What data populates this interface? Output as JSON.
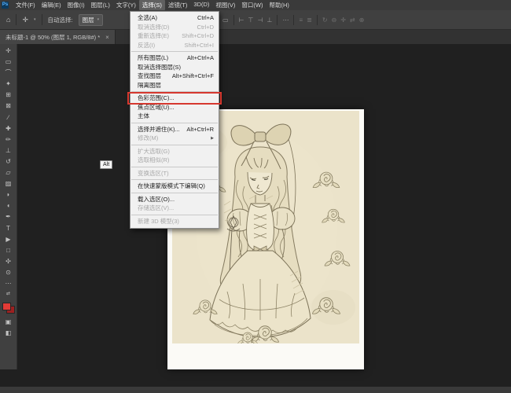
{
  "app": {
    "name": "Photoshop",
    "accent_red": "#d6382f",
    "ps_badge": "Ps"
  },
  "menubar": {
    "active_index": 5,
    "items": [
      {
        "id": "file",
        "label": "文件(F)"
      },
      {
        "id": "edit",
        "label": "编辑(E)"
      },
      {
        "id": "image",
        "label": "图像(I)"
      },
      {
        "id": "layer",
        "label": "图层(L)"
      },
      {
        "id": "type",
        "label": "文字(Y)"
      },
      {
        "id": "select",
        "label": "选择(S)"
      },
      {
        "id": "filter",
        "label": "滤镜(T)"
      },
      {
        "id": "3d",
        "label": "3D(D)"
      },
      {
        "id": "view",
        "label": "视图(V)"
      },
      {
        "id": "window",
        "label": "窗口(W)"
      },
      {
        "id": "help",
        "label": "帮助(H)"
      }
    ]
  },
  "options_bar": {
    "home_icon": "⌂",
    "move_icon": "✛",
    "chevron": "▾",
    "auto_select_label": "自动选择:",
    "auto_select_value": "图层",
    "right_groups": [
      {
        "items": [
          {
            "name": "show-transform-controls-icon",
            "glyph": "▭"
          }
        ]
      },
      {
        "items": [
          {
            "name": "align-left-icon",
            "glyph": "⊢"
          },
          {
            "name": "align-center-icon",
            "glyph": "⊤"
          },
          {
            "name": "align-right-icon",
            "glyph": "⊣"
          },
          {
            "name": "align-top-icon",
            "glyph": "⊥"
          }
        ]
      },
      {
        "items": [
          {
            "name": "more-options-icon",
            "glyph": "⋯"
          }
        ]
      },
      {
        "items": [
          {
            "name": "distribute-icon",
            "glyph": "≡",
            "faint": true
          },
          {
            "name": "distribute-v-icon",
            "glyph": "≣",
            "faint": true
          }
        ]
      },
      {
        "items": [
          {
            "name": "3d-rotate-icon",
            "glyph": "↻",
            "faint": true
          },
          {
            "name": "3d-roll-icon",
            "glyph": "⊖",
            "faint": true
          },
          {
            "name": "3d-drag-icon",
            "glyph": "✛",
            "faint": true
          },
          {
            "name": "3d-slide-icon",
            "glyph": "⇄",
            "faint": true
          },
          {
            "name": "3d-scale-icon",
            "glyph": "⊕",
            "faint": true
          }
        ]
      }
    ]
  },
  "document_tab": {
    "title": "未标题-1 @ 50% (图层 1, RGB/8#) *",
    "close": "×"
  },
  "toolbar": {
    "tools": [
      {
        "name": "move-tool",
        "glyph": "✛"
      },
      {
        "name": "marquee-tool",
        "glyph": "▭"
      },
      {
        "name": "lasso-tool",
        "glyph": "⌒"
      },
      {
        "name": "quick-selection-tool",
        "glyph": "✦"
      },
      {
        "name": "crop-tool",
        "glyph": "⊞"
      },
      {
        "name": "frame-tool",
        "glyph": "⊠"
      },
      {
        "name": "eyedropper-tool",
        "glyph": "∕"
      },
      {
        "name": "healing-brush-tool",
        "glyph": "✚"
      },
      {
        "name": "brush-tool",
        "glyph": "✏"
      },
      {
        "name": "clone-stamp-tool",
        "glyph": "⊥"
      },
      {
        "name": "history-brush-tool",
        "glyph": "↺"
      },
      {
        "name": "eraser-tool",
        "glyph": "▱"
      },
      {
        "name": "gradient-tool",
        "glyph": "▨"
      },
      {
        "name": "blur-tool",
        "glyph": "◗"
      },
      {
        "name": "dodge-tool",
        "glyph": "◖"
      },
      {
        "name": "pen-tool",
        "glyph": "✒"
      },
      {
        "name": "type-tool",
        "glyph": "T"
      },
      {
        "name": "path-select-tool",
        "glyph": "▶"
      },
      {
        "name": "shape-tool",
        "glyph": "□"
      },
      {
        "name": "hand-tool",
        "glyph": "✣"
      },
      {
        "name": "zoom-tool",
        "glyph": "⊙"
      },
      {
        "name": "edit-toolbar-icon",
        "glyph": "⋯"
      }
    ],
    "swap_colors_icon": "⇄",
    "foreground_color": "#e23b36",
    "background_color": "#9c2020",
    "bottom_tools": [
      {
        "name": "quick-mask-mode-button",
        "glyph": "▣"
      },
      {
        "name": "screen-mode-button",
        "glyph": "◧"
      }
    ]
  },
  "select_menu": {
    "items": [
      {
        "label": "全选(A)",
        "shortcut": "Ctrl+A",
        "enabled": true
      },
      {
        "label": "取消选择(D)",
        "shortcut": "Ctrl+D",
        "enabled": false
      },
      {
        "label": "重新选择(E)",
        "shortcut": "Shift+Ctrl+D",
        "enabled": false
      },
      {
        "label": "反选(I)",
        "shortcut": "Shift+Ctrl+I",
        "enabled": false
      },
      {
        "separator": true
      },
      {
        "label": "所有图层(L)",
        "shortcut": "Alt+Ctrl+A",
        "enabled": true
      },
      {
        "label": "取消选择图层(S)",
        "enabled": true
      },
      {
        "label": "查找图层",
        "shortcut": "Alt+Shift+Ctrl+F",
        "enabled": true
      },
      {
        "label": "隔离图层",
        "enabled": true
      },
      {
        "separator": true
      },
      {
        "label": "色彩范围(C)...",
        "enabled": true,
        "highlighted": true
      },
      {
        "label": "焦点区域(U)...",
        "enabled": true
      },
      {
        "label": "主体",
        "enabled": true
      },
      {
        "separator": true
      },
      {
        "label": "选择并遮住(K)...",
        "shortcut": "Alt+Ctrl+R",
        "enabled": true
      },
      {
        "label": "修改(M)",
        "submenu": true,
        "enabled": false
      },
      {
        "separator": true
      },
      {
        "label": "扩大选取(G)",
        "enabled": false
      },
      {
        "label": "选取相似(R)",
        "enabled": false
      },
      {
        "separator": true
      },
      {
        "label": "变换选区(T)",
        "enabled": false
      },
      {
        "separator": true
      },
      {
        "label": "在快速蒙版模式下编辑(Q)",
        "enabled": true
      },
      {
        "separator": true
      },
      {
        "label": "载入选区(O)...",
        "enabled": true
      },
      {
        "label": "存储选区(V)...",
        "enabled": false
      },
      {
        "separator": true
      },
      {
        "label": "新建 3D 模型(3)",
        "enabled": false
      }
    ]
  },
  "overlay": {
    "alt_key": "Alt"
  }
}
